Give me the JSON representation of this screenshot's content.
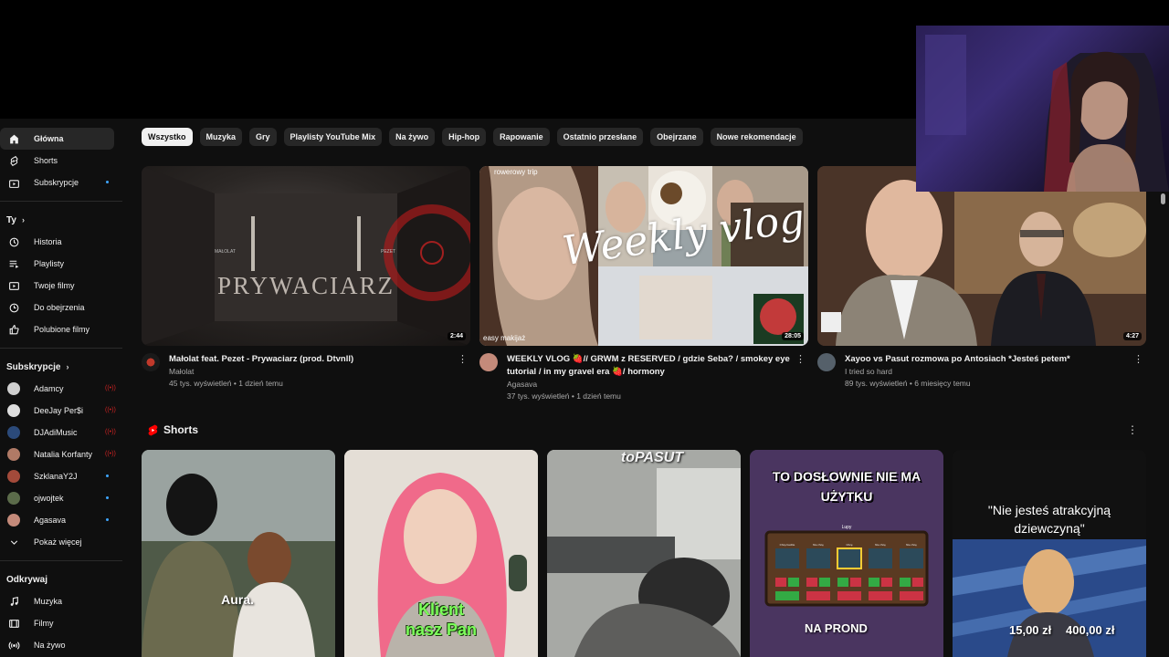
{
  "sidebar": {
    "main_items": [
      {
        "label": "Główna",
        "icon": "home-icon"
      },
      {
        "label": "Shorts",
        "icon": "shorts-icon"
      },
      {
        "label": "Subskrypcje",
        "icon": "subscriptions-icon"
      }
    ],
    "you_heading": "Ty",
    "you_items": [
      {
        "label": "Historia",
        "icon": "history-icon"
      },
      {
        "label": "Playlisty",
        "icon": "playlist-icon"
      },
      {
        "label": "Twoje filmy",
        "icon": "your-videos-icon"
      },
      {
        "label": "Do obejrzenia",
        "icon": "watch-later-icon"
      },
      {
        "label": "Polubione filmy",
        "icon": "like-icon"
      }
    ],
    "subs_heading": "Subskrypcje",
    "subscriptions": [
      {
        "label": "Adamcy",
        "status": "live",
        "color": "#cfcfcf"
      },
      {
        "label": "DeeJay Per$i",
        "status": "live",
        "color": "#dddddd"
      },
      {
        "label": "DJAdiMusic",
        "status": "live",
        "color": "#2b4a7a"
      },
      {
        "label": "Natalia Korfanty",
        "status": "live",
        "color": "#b07a66"
      },
      {
        "label": "SzklanaY2J",
        "status": "new",
        "color": "#a34a3a"
      },
      {
        "label": "ojwojtek",
        "status": "new",
        "color": "#5b6b4a"
      },
      {
        "label": "Agasava",
        "status": "new",
        "color": "#c48a7a"
      }
    ],
    "show_more": "Pokaż więcej",
    "explore_heading": "Odkrywaj",
    "explore_items": [
      {
        "label": "Muzyka",
        "icon": "music-icon"
      },
      {
        "label": "Filmy",
        "icon": "film-icon"
      },
      {
        "label": "Na żywo",
        "icon": "live-icon"
      }
    ]
  },
  "chips": [
    "Wszystko",
    "Muzyka",
    "Gry",
    "Playlisty YouTube Mix",
    "Na żywo",
    "Hip-hop",
    "Rapowanie",
    "Ostatnio przesłane",
    "Obejrzane",
    "Nowe rekomendacje"
  ],
  "videos": [
    {
      "title": "Małolat feat. Pezet - Prywaciarz (prod. Dtvnll)",
      "channel": "Małolat",
      "meta": "45 tys. wyświetleń • 1 dzień temu",
      "duration": "2:44",
      "thumb_text": "PRYWACIARZ",
      "thumb_small_left": "MAŁOLAT",
      "thumb_small_right": "PEZET"
    },
    {
      "title": "WEEKLY VLOG 🍓// GRWM z RESERVED / gdzie Seba? / smokey eye tutorial / in my gravel era 🍓/ hormony",
      "channel": "Agasava",
      "meta": "37 tys. wyświetleń • 1 dzień temu",
      "duration": "28:05",
      "thumb_text": "Weekly vlog",
      "thumb_caption_top": "rowerowy trip",
      "thumb_caption_bottom": "easy makijaż"
    },
    {
      "title": "Xayoo vs Pasut rozmowa po Antosiach *Jesteś petem*",
      "channel": "I tried so hard",
      "meta": "89 tys. wyświetleń • 6 miesięcy temu",
      "duration": "4:27"
    }
  ],
  "shorts_heading": "Shorts",
  "shorts": [
    {
      "caption": "Aura."
    },
    {
      "caption_line1": "Klient",
      "caption_line2": "nasz Pan"
    },
    {
      "caption": "toPASUT"
    },
    {
      "caption_top_line1": "TO DOSŁOWNIE NIE MA",
      "caption_top_line2": "UŻYTKU",
      "caption_bottom": "NA PROND",
      "game_label": "Lupy",
      "cells": [
        "Chcę badzie",
        "Nie chcę",
        "Chcę",
        "Nie chcę",
        "Nie chcę"
      ]
    },
    {
      "caption_line1": "\"Nie jesteś atrakcyjną",
      "caption_line2": "dziewczyną\"",
      "price1": "15,00 zł",
      "price2": "400,00 zł"
    }
  ],
  "colors": {
    "accent_red": "#ff0000",
    "background": "#0f0f0f",
    "chip": "#272727",
    "new_dot": "#3ea6ff"
  }
}
